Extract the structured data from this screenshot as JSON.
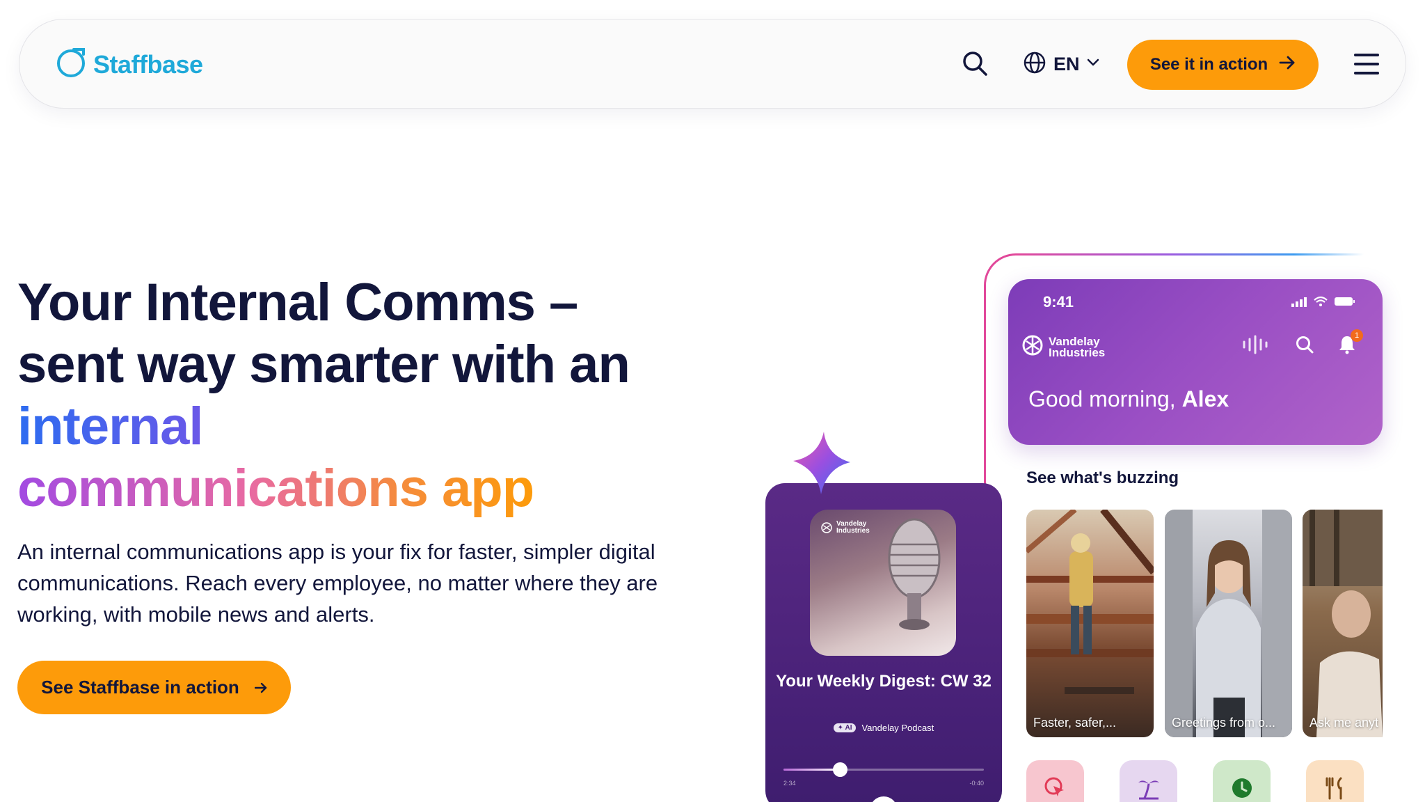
{
  "header": {
    "logo_text": "Staffbase",
    "language": "EN",
    "cta_label": "See it in action"
  },
  "hero": {
    "headline_part1": "Your Internal Comms – sent way smarter with an ",
    "headline_highlight1": "internal",
    "headline_highlight2": "communications app",
    "lead": "An internal communications app is your fix for faster, simpler digital communications. Reach every employee, no matter where they are working, with mobile news and alerts.",
    "cta_label": "See Staffbase in action"
  },
  "phone": {
    "time": "9:41",
    "brand": "Vandelay Industries",
    "greeting_prefix": "Good morning, ",
    "greeting_name": "Alex",
    "notification_count": "1",
    "section_title": "See what's buzzing",
    "cards": [
      {
        "caption": "Faster, safer,..."
      },
      {
        "caption": "Greetings from o..."
      },
      {
        "caption": "Ask me anyt"
      }
    ],
    "shortcut_colors": [
      "#f7c6cf",
      "#e6d7f0",
      "#cfe8c9",
      "#fbe0c2"
    ]
  },
  "podcast": {
    "art_brand": "Vandelay Industries",
    "title": "Your Weekly Digest: CW 32",
    "ai_label": "AI",
    "source": "Vandelay Podcast",
    "progress": 0.28,
    "time_elapsed": "2:34",
    "time_remaining": "-0:40"
  },
  "colors": {
    "accent": "#fd9b0a",
    "brand": "#1fa9d9",
    "navy": "#12163b",
    "app_purple": "#8a45bf"
  }
}
